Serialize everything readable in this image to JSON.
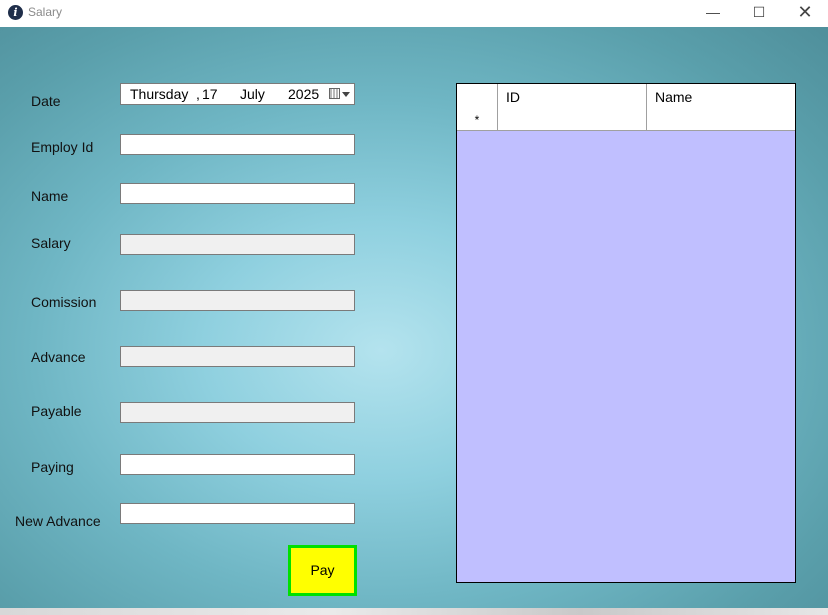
{
  "window": {
    "title": "Salary",
    "icon": "info-icon",
    "controls": [
      "minimize-icon",
      "maximize-icon",
      "close-icon"
    ]
  },
  "form": {
    "date_label": "Date",
    "date_value": {
      "weekday": "Thursday",
      "sep": ",",
      "day": "17",
      "month": "July",
      "year": "2025"
    },
    "employ_id_label": "Employ Id",
    "name_label": "Name",
    "salary_label": "Salary",
    "comission_label": "Comission",
    "advance_label": "Advance",
    "payable_label": "Payable",
    "paying_label": "Paying",
    "new_advance_label": "New Advance",
    "pay_label": "Pay"
  },
  "grid": {
    "columns": [
      "ID",
      "Name"
    ],
    "new_row_marker": "*"
  },
  "colors": {
    "pay_button_bg": "#ffff00",
    "pay_button_border": "#00e000",
    "grid_bg": "#c0bfff"
  }
}
